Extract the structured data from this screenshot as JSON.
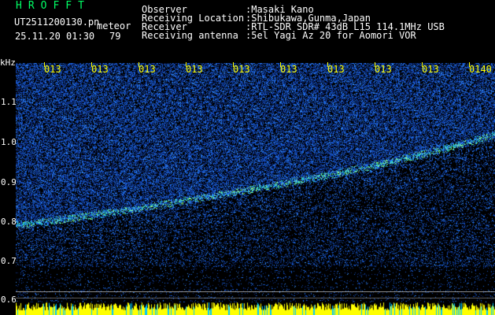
{
  "header": {
    "title": "HROFFT",
    "filename": "UT2511200130.pn",
    "event_label": "meteor",
    "date_time": "25.11.20 01:30",
    "count": "79"
  },
  "meta": [
    {
      "label": "Observer",
      "value": ":Masaki Kano"
    },
    {
      "label": "Receiving Location",
      "value": ":Shibukawa,Gunma,Japan"
    },
    {
      "label": "Receiver",
      "value": ":RTL-SDR SDR# 43dB L15 114.1MHz USB"
    },
    {
      "label": "Receiving antenna",
      "value": ":5el Yagi Az 20 for Aomori VOR"
    }
  ],
  "axis": {
    "y_unit": "kHz",
    "y_ticks": [
      "1.1",
      "1.0",
      "0.9",
      "0.8",
      "0.7",
      "0.6"
    ],
    "x_ticks": [
      "013",
      "013",
      "013",
      "013",
      "013",
      "013",
      "013",
      "013",
      "013",
      "0140"
    ]
  },
  "colors": {
    "background": "#000000",
    "text": "#ffffff",
    "title": "#00ff66",
    "axis_labels": "#ffff00",
    "signal_low": "#0a1e78",
    "signal_mid": "#2f6bff",
    "signal_high": "#7cff7c",
    "strip": "#ffff00"
  }
}
